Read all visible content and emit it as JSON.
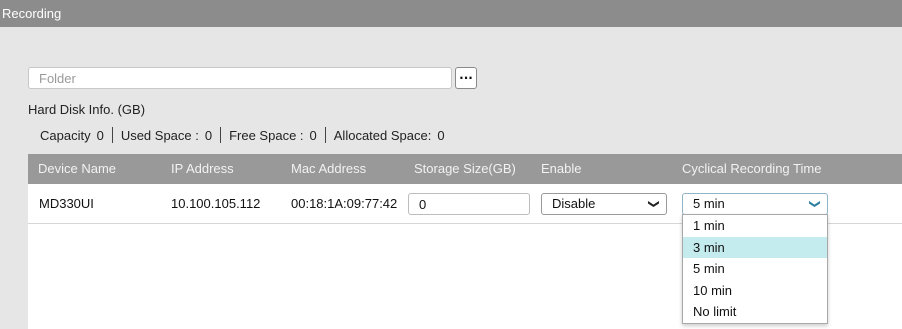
{
  "panel": {
    "title": "Recording"
  },
  "folder": {
    "value": "",
    "placeholder": "Folder",
    "browse_label": "···"
  },
  "hard_disk": {
    "title": "Hard Disk Info. (GB)",
    "capacity_label": "Capacity",
    "capacity_value": "0",
    "used_label": "Used Space :",
    "used_value": "0",
    "free_label": "Free Space :",
    "free_value": "0",
    "allocated_label": "Allocated Space:",
    "allocated_value": "0"
  },
  "table": {
    "headers": [
      "Device Name",
      "IP Address",
      "Mac Address",
      "Storage Size(GB)",
      "Enable",
      "Cyclical Recording Time"
    ],
    "rows": [
      {
        "device_name": "MD330UI",
        "ip": "10.100.105.112",
        "mac": "00:18:1A:09:77:42",
        "storage_size": "0",
        "enable": "Disable",
        "cyclical_time": "5 min"
      }
    ]
  },
  "cyclical_dropdown": {
    "options": [
      "1 min",
      "3 min",
      "5 min",
      "10 min",
      "No limit"
    ],
    "highlighted": "3 min"
  },
  "colors": {
    "title_bar": "#8c8c8c",
    "table_header": "#999999",
    "highlight": "#c4ecee",
    "panel_bg": "#e6e6e6"
  },
  "icons": {
    "select_arrow": "chevron-down-icon"
  }
}
